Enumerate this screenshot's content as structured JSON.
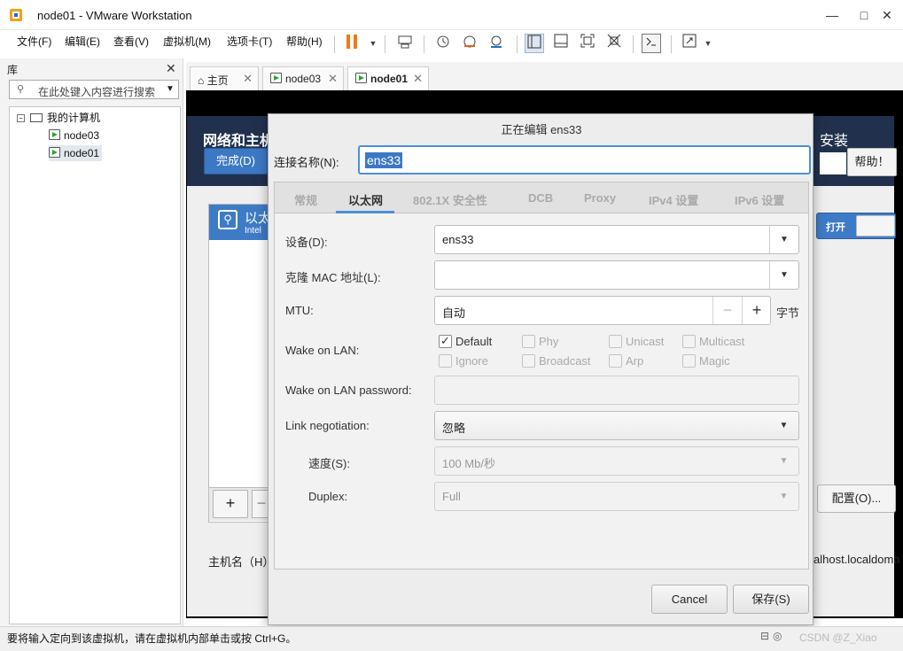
{
  "window": {
    "title": "node01 - VMware Workstation",
    "minimize": "—",
    "maximize": "□",
    "close": "✕"
  },
  "menu": [
    "文件(F)",
    "编辑(E)",
    "查看(V)",
    "虚拟机(M)",
    "选项卡(T)",
    "帮助(H)"
  ],
  "toolbar_icons": [
    "pause-icon",
    "send-keys-icon",
    "snapshot-icon",
    "revert-snapshot-icon",
    "snapshot-manager-icon",
    "library-view-icon",
    "thumbnail-view-icon",
    "fullscreen-icon",
    "unity-icon",
    "console-icon",
    "stretch-icon"
  ],
  "library": {
    "title": "库",
    "close": "✕",
    "search_placeholder": "在此处键入内容进行搜索",
    "root": "我的计算机",
    "items": [
      "node03",
      "node01"
    ]
  },
  "tabs": [
    {
      "label": "主页"
    },
    {
      "label": "node03"
    },
    {
      "label": "node01"
    }
  ],
  "installer": {
    "header": "网络和主机",
    "install": "安装",
    "done": "完成(D)",
    "help": "帮助！",
    "net_title": "以太",
    "net_sub": "Intel",
    "toggle": "打开",
    "add": "+",
    "remove": "−",
    "config": "配置(O)...",
    "hostname_label": "主机名（H）",
    "hostname_value": "alhost.localdoma"
  },
  "dialog": {
    "title": "正在编辑 ens33",
    "conn_name_label": "连接名称(N):",
    "conn_name_value": "ens33",
    "tabs": [
      "常规",
      "以太网",
      "802.1X 安全性",
      "DCB",
      "Proxy",
      "IPv4 设置",
      "IPv6 设置"
    ],
    "active_tab": "以太网",
    "device_label": "设备(D):",
    "device_value": "ens33",
    "mac_label": "克隆 MAC 地址(L):",
    "mac_value": "",
    "mtu_label": "MTU:",
    "mtu_value": "自动",
    "mtu_minus": "−",
    "mtu_plus": "+",
    "mtu_unit": "字节",
    "wol_label": "Wake on LAN:",
    "wol_options": [
      {
        "label": "Default",
        "checked": true
      },
      {
        "label": "Phy",
        "checked": false
      },
      {
        "label": "Unicast",
        "checked": false
      },
      {
        "label": "Multicast",
        "checked": false
      },
      {
        "label": "Ignore",
        "checked": false
      },
      {
        "label": "Broadcast",
        "checked": false
      },
      {
        "label": "Arp",
        "checked": false
      },
      {
        "label": "Magic",
        "checked": false
      }
    ],
    "wol_password_label": "Wake on LAN password:",
    "wol_password_value": "",
    "link_neg_label": "Link negotiation:",
    "link_neg_value": "忽略",
    "speed_label": "速度(S):",
    "speed_value": "100 Mb/秒",
    "duplex_label": "Duplex:",
    "duplex_value": "Full",
    "cancel": "Cancel",
    "save": "保存(S)"
  },
  "status": {
    "message": "要将输入定向到该虚拟机，请在虚拟机内部单击或按 Ctrl+G。",
    "watermark": "CSDN @Z_Xiao"
  }
}
